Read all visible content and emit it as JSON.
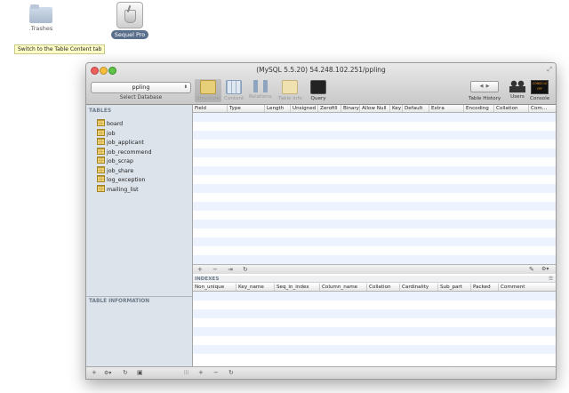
{
  "desktop": {
    "trashes_label": ".Trashes",
    "app_label": "Sequel Pro",
    "tooltip": "Switch to the Table Content tab"
  },
  "window": {
    "title": "(MySQL 5.5.20) 54.248.102.251/ppling",
    "database": "ppling",
    "select_database_caption": "Select Database"
  },
  "toolbar": {
    "structure": "Structure",
    "content": "Content",
    "relations": "Relations",
    "table_info": "Table Info",
    "query": "Query",
    "table_history": "Table History",
    "users": "Users",
    "console": "Console",
    "console_icon_text": "CONSO LE OFF"
  },
  "sidebar": {
    "tables_heading": "TABLES",
    "tables": [
      "board",
      "job",
      "job_applicant",
      "job_recommend",
      "job_scrap",
      "job_share",
      "log_exception",
      "mailing_list"
    ],
    "table_information_heading": "TABLE INFORMATION"
  },
  "structure": {
    "columns": [
      "Field",
      "Type",
      "Length",
      "Unsigned",
      "Zerofill",
      "Binary",
      "Allow Null",
      "Key",
      "Default",
      "Extra",
      "Encoding",
      "Collation",
      "Com..."
    ]
  },
  "indexes": {
    "heading": "INDEXES",
    "columns": [
      "Non_unique",
      "Key_name",
      "Seq_in_index",
      "Column_name",
      "Collation",
      "Cardinality",
      "Sub_part",
      "Packed",
      "Comment"
    ]
  },
  "controls": {
    "add": "+",
    "remove": "−",
    "duplicate": "⇥",
    "refresh": "↻",
    "gear": "⚙▾",
    "edit": "✎",
    "menu": "☰",
    "info": "▣",
    "resize": "|||"
  },
  "colors": {
    "sidebar_bg": "#dde3ea",
    "stripe": "#edf3fe",
    "close": "#ee5f5b",
    "minimize": "#f7be3d",
    "zoom": "#5fc348"
  }
}
